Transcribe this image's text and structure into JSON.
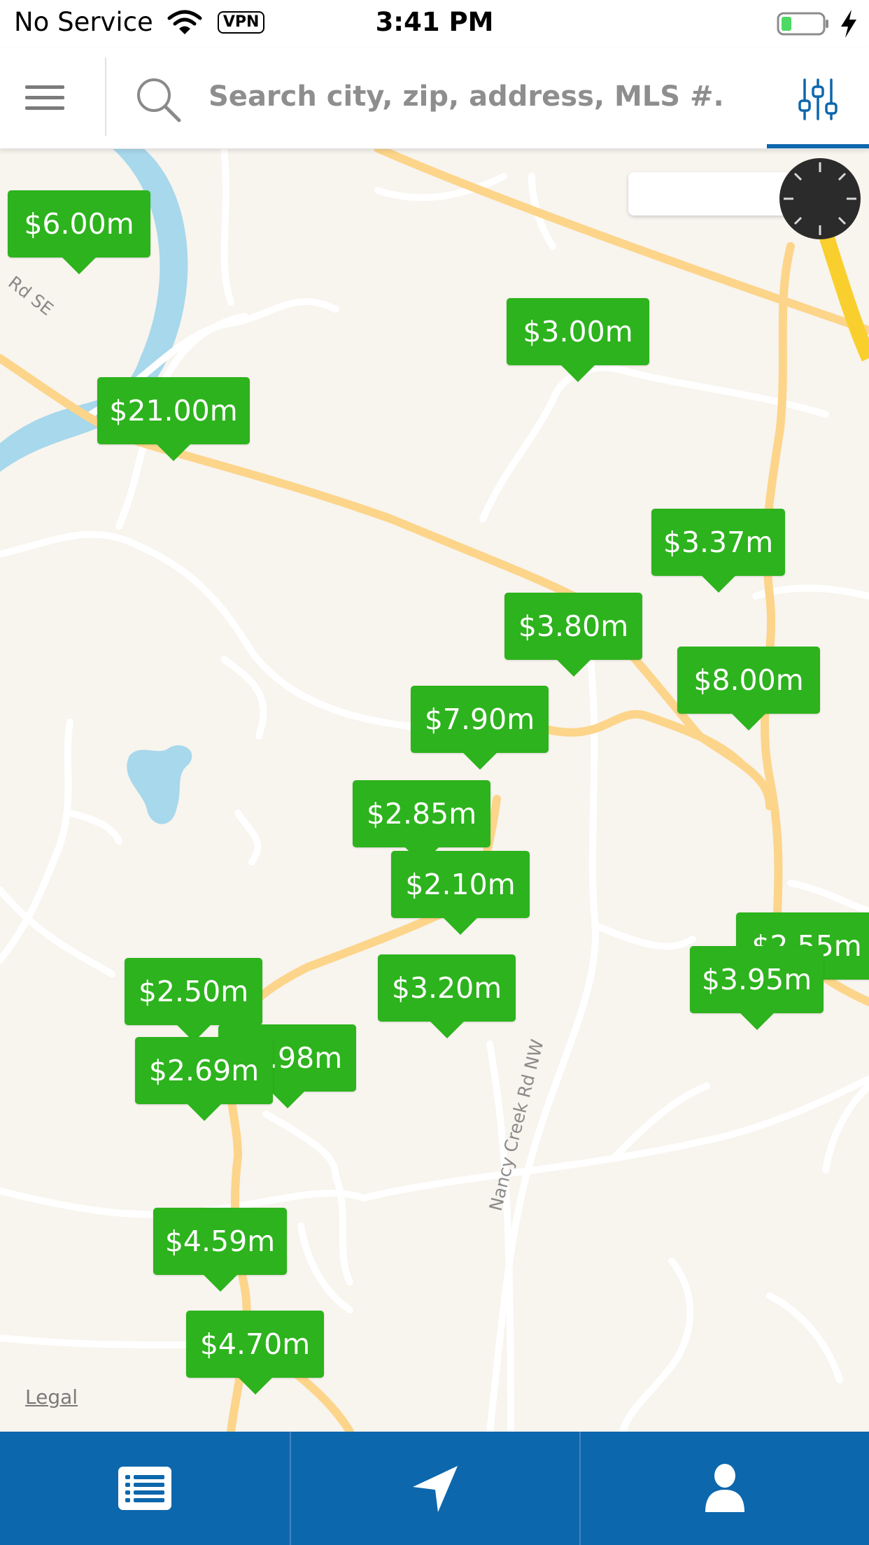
{
  "status_bar": {
    "carrier": "No Service",
    "time": "3:41 PM",
    "vpn_label": "VPN",
    "battery_level": 0.25
  },
  "search": {
    "placeholder": "Search city, zip, address, MLS #..."
  },
  "map": {
    "road_labels": [
      "Rd SE",
      "Nancy Creek Rd NW"
    ],
    "legal_label": "Legal",
    "listings": [
      {
        "price": "$6.00m"
      },
      {
        "price": "$3.00m"
      },
      {
        "price": "$21.00m"
      },
      {
        "price": "$3.37m"
      },
      {
        "price": "$3.80m"
      },
      {
        "price": "$8.00m"
      },
      {
        "price": "$7.90m"
      },
      {
        "price": "$2.85m"
      },
      {
        "price": "$2.10m"
      },
      {
        "price": "$2.55m"
      },
      {
        "price": "$3.95m"
      },
      {
        "price": "$3.20m"
      },
      {
        "price": "$2.50m"
      },
      {
        "price": "$2.98m"
      },
      {
        "price": "$2.69m"
      },
      {
        "price": "$4.59m"
      },
      {
        "price": "$4.70m"
      }
    ]
  },
  "tab_bar": {
    "tabs": [
      {
        "icon": "list-icon"
      },
      {
        "icon": "location-arrow-icon"
      },
      {
        "icon": "user-icon"
      }
    ]
  },
  "colors": {
    "brand_blue": "#0d67ad",
    "pin_green": "#2db31d",
    "map_background": "#f8f4ee",
    "water": "#a7d8ec",
    "major_road": "#fcd58a",
    "highway": "#f9cf2d"
  }
}
